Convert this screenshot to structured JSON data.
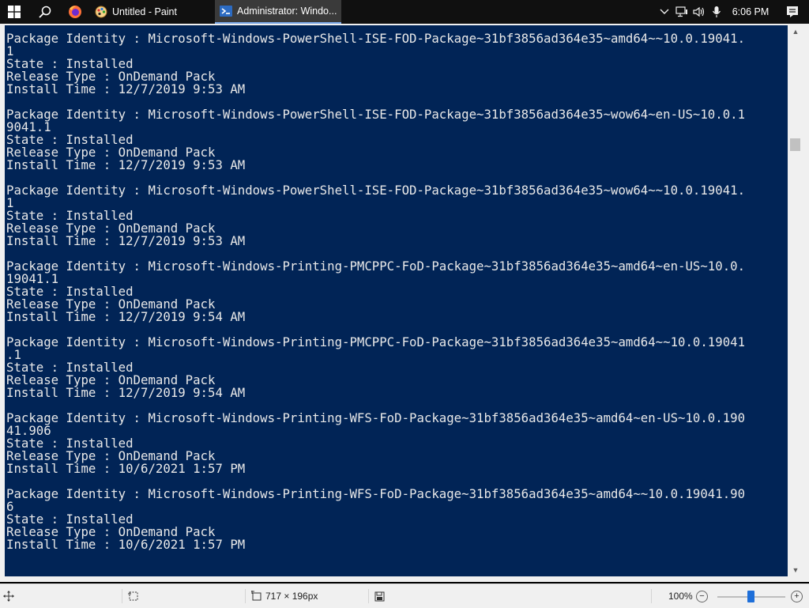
{
  "taskbar": {
    "apps": [
      {
        "label": "Untitled - Paint",
        "icon": "paint-icon",
        "active": false
      },
      {
        "label": "Administrator: Windo...",
        "icon": "powershell-icon",
        "active": true
      }
    ],
    "clock": "6:06 PM"
  },
  "console": {
    "colors": {
      "background": "#012456",
      "text": "#e8e8e8"
    },
    "entries": [
      {
        "lines": [
          "Package Identity : Microsoft-Windows-PowerShell-ISE-FOD-Package~31bf3856ad364e35~amd64~~10.0.19041.",
          "1",
          "State : Installed",
          "Release Type : OnDemand Pack",
          "Install Time : 12/7/2019 9:53 AM"
        ]
      },
      {
        "lines": [
          "Package Identity : Microsoft-Windows-PowerShell-ISE-FOD-Package~31bf3856ad364e35~wow64~en-US~10.0.1",
          "9041.1",
          "State : Installed",
          "Release Type : OnDemand Pack",
          "Install Time : 12/7/2019 9:53 AM"
        ]
      },
      {
        "lines": [
          "Package Identity : Microsoft-Windows-PowerShell-ISE-FOD-Package~31bf3856ad364e35~wow64~~10.0.19041.",
          "1",
          "State : Installed",
          "Release Type : OnDemand Pack",
          "Install Time : 12/7/2019 9:53 AM"
        ]
      },
      {
        "lines": [
          "Package Identity : Microsoft-Windows-Printing-PMCPPC-FoD-Package~31bf3856ad364e35~amd64~en-US~10.0.",
          "19041.1",
          "State : Installed",
          "Release Type : OnDemand Pack",
          "Install Time : 12/7/2019 9:54 AM"
        ]
      },
      {
        "lines": [
          "Package Identity : Microsoft-Windows-Printing-PMCPPC-FoD-Package~31bf3856ad364e35~amd64~~10.0.19041",
          ".1",
          "State : Installed",
          "Release Type : OnDemand Pack",
          "Install Time : 12/7/2019 9:54 AM"
        ]
      },
      {
        "lines": [
          "Package Identity : Microsoft-Windows-Printing-WFS-FoD-Package~31bf3856ad364e35~amd64~en-US~10.0.190",
          "41.906",
          "State : Installed",
          "Release Type : OnDemand Pack",
          "Install Time : 10/6/2021 1:57 PM"
        ]
      },
      {
        "lines": [
          "Package Identity : Microsoft-Windows-Printing-WFS-FoD-Package~31bf3856ad364e35~amd64~~10.0.19041.90",
          "6",
          "State : Installed",
          "Release Type : OnDemand Pack",
          "Install Time : 10/6/2021 1:57 PM"
        ]
      }
    ]
  },
  "statusbar": {
    "image_size": "717 × 196px",
    "zoom": "100%",
    "zoom_out_label": "−",
    "zoom_in_label": "+"
  }
}
